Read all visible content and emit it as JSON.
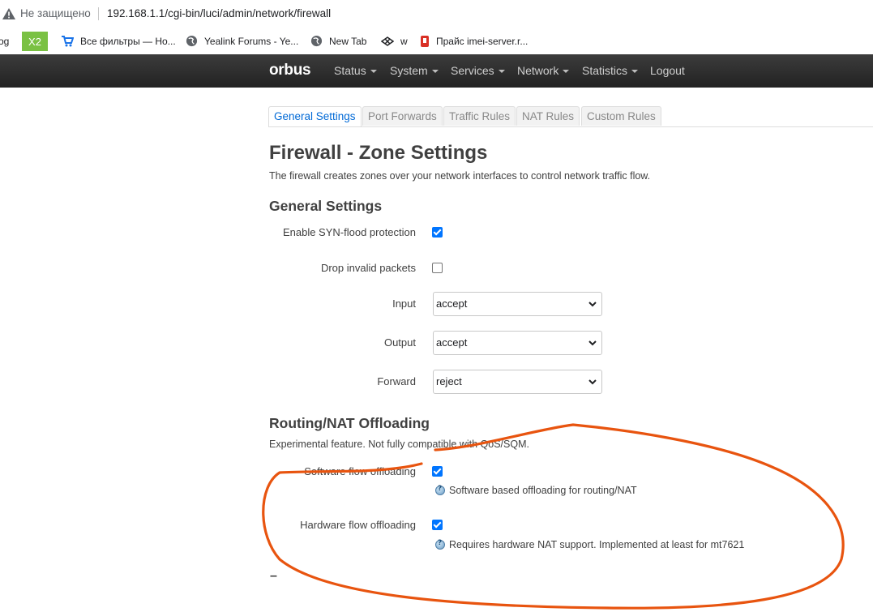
{
  "browser": {
    "security_label": "Не защищено",
    "url": "192.168.1.1/cgi-bin/luci/admin/network/firewall",
    "bookmarks": [
      {
        "label": "og"
      },
      {
        "label": "Все фильтры — Но..."
      },
      {
        "label": "Yealink Forums - Ye..."
      },
      {
        "label": "New Tab"
      },
      {
        "label": "w"
      },
      {
        "label": "Прайс imei-server.r..."
      }
    ],
    "accent_bookmark_icon_color": "#7ac143"
  },
  "navbar": {
    "brand": "orbus",
    "items": [
      {
        "label": "Status"
      },
      {
        "label": "System"
      },
      {
        "label": "Services"
      },
      {
        "label": "Network"
      },
      {
        "label": "Statistics"
      },
      {
        "label": "Logout"
      }
    ]
  },
  "tabs": [
    {
      "label": "General Settings",
      "active": true
    },
    {
      "label": "Port Forwards"
    },
    {
      "label": "Traffic Rules"
    },
    {
      "label": "NAT Rules"
    },
    {
      "label": "Custom Rules"
    }
  ],
  "page": {
    "title": "Firewall - Zone Settings",
    "description": "The firewall creates zones over your network interfaces to control network traffic flow."
  },
  "general": {
    "heading": "General Settings",
    "syn_flood_label": "Enable SYN-flood protection",
    "syn_flood_checked": true,
    "drop_invalid_label": "Drop invalid packets",
    "drop_invalid_checked": false,
    "input_label": "Input",
    "input_value": "accept",
    "output_label": "Output",
    "output_value": "accept",
    "forward_label": "Forward",
    "forward_value": "reject"
  },
  "offloading": {
    "heading": "Routing/NAT Offloading",
    "description": "Experimental feature. Not fully compatible with QoS/SQM.",
    "software_label": "Software flow offloading",
    "software_checked": true,
    "software_hint": "Software based offloading for routing/NAT",
    "hardware_label": "Hardware flow offloading",
    "hardware_checked": true,
    "hardware_hint": "Requires hardware NAT support. Implemented at least for mt7621"
  },
  "footer_dash": "–",
  "colors": {
    "navbar": "#222222",
    "active_tab": "#0069d6",
    "checkbox": "#0075ff",
    "annotation": "#e8540f"
  }
}
